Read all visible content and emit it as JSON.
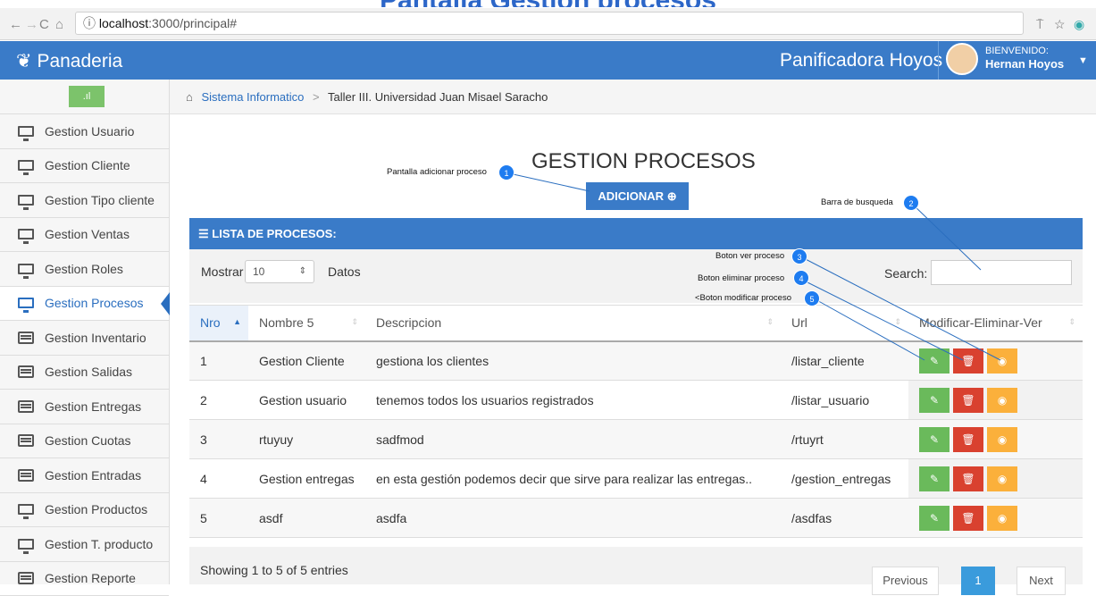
{
  "doc_title": "Pantalla Gestion procesos",
  "browser": {
    "url_host": "localhost",
    "url_rest": ":3000/principal#"
  },
  "topnav": {
    "brand": "Panaderia",
    "company": "Panificadora Hoyos",
    "welcome": "BIENVENIDO:",
    "user": "Hernan Hoyos"
  },
  "sidebar": {
    "items": [
      {
        "label": "Gestion Usuario",
        "icon": "monitor-icon"
      },
      {
        "label": "Gestion Cliente",
        "icon": "monitor-icon"
      },
      {
        "label": "Gestion Tipo cliente",
        "icon": "monitor-icon"
      },
      {
        "label": "Gestion Ventas",
        "icon": "monitor-icon"
      },
      {
        "label": "Gestion Roles",
        "icon": "monitor-icon"
      },
      {
        "label": "Gestion Procesos",
        "icon": "monitor-icon",
        "active": true
      },
      {
        "label": "Gestion Inventario",
        "icon": "table-icon"
      },
      {
        "label": "Gestion Salidas",
        "icon": "table-icon"
      },
      {
        "label": "Gestion Entregas",
        "icon": "table-icon"
      },
      {
        "label": "Gestion Cuotas",
        "icon": "table-icon"
      },
      {
        "label": "Gestion Entradas",
        "icon": "table-icon"
      },
      {
        "label": "Gestion Productos",
        "icon": "monitor-icon"
      },
      {
        "label": "Gestion T. producto",
        "icon": "monitor-icon"
      },
      {
        "label": "Gestion Reporte",
        "icon": "table-icon"
      }
    ]
  },
  "breadcrumb": {
    "home": "Sistema Informatico",
    "current": "Taller III. Universidad Juan Misael Saracho"
  },
  "main": {
    "title": "GESTION PROCESOS",
    "add_button": "ADICIONAR",
    "panel_title": "LISTA DE PROCESOS:",
    "show_label": "Mostrar",
    "show_value": "10",
    "show_suffix": "Datos",
    "search_label": "Search:",
    "columns": [
      "Nro",
      "Nombre 5",
      "Descripcion",
      "Url",
      "Modificar-Eliminar-Ver"
    ],
    "rows": [
      {
        "nro": "1",
        "nombre": "Gestion Cliente",
        "descripcion": "gestiona los clientes",
        "url": "/listar_cliente"
      },
      {
        "nro": "2",
        "nombre": "Gestion usuario",
        "descripcion": "tenemos todos los usuarios registrados",
        "url": "/listar_usuario"
      },
      {
        "nro": "3",
        "nombre": "rtuyuy",
        "descripcion": "sadfmod",
        "url": "/rtuyrt"
      },
      {
        "nro": "4",
        "nombre": "Gestion entregas",
        "descripcion": "en esta gestión podemos decir que sirve para realizar las entregas..",
        "url": "/gestion_entregas"
      },
      {
        "nro": "5",
        "nombre": "asdf",
        "descripcion": "asdfa",
        "url": "/asdfas"
      }
    ],
    "entries_info": "Showing 1 to 5 of 5 entries",
    "pagination": {
      "previous": "Previous",
      "current": "1",
      "next": "Next"
    }
  },
  "annotations": [
    {
      "num": "1",
      "text": "Pantalla adicionar proceso"
    },
    {
      "num": "2",
      "text": "Barra de busqueda"
    },
    {
      "num": "3",
      "text": "Boton ver proceso"
    },
    {
      "num": "4",
      "text": "Boton eliminar proceso"
    },
    {
      "num": "5",
      "text": "<Boton modificar proceso"
    }
  ],
  "colors": {
    "primary": "#3a7bc8",
    "edit": "#6aba5b",
    "delete": "#d9412f",
    "view": "#fbb03b",
    "badge": "#1e7cf0"
  }
}
